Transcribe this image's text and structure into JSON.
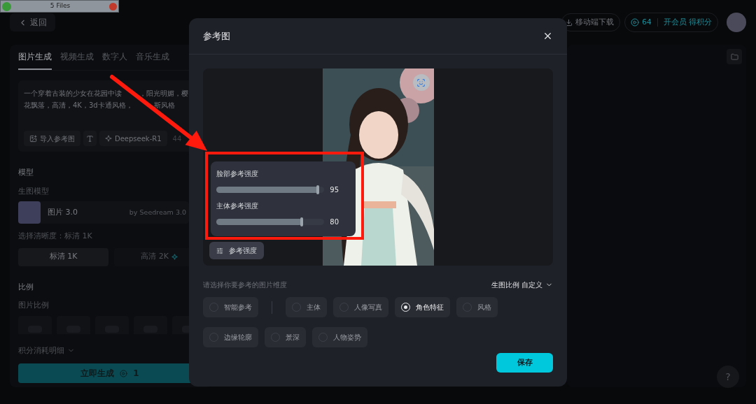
{
  "capture_bar": {
    "title": "5 Files"
  },
  "header": {
    "back": "返回",
    "mobile_download": "移动端下载",
    "points": "64",
    "membership": "开会员 得积分"
  },
  "left_panel": {
    "tabs": [
      {
        "label": "图片生成",
        "selected": true
      },
      {
        "label": "视频生成",
        "selected": false
      },
      {
        "label": "数字人",
        "selected": false
      },
      {
        "label": "音乐生成",
        "selected": false
      }
    ],
    "prompt_lines": [
      {
        "before": "一个穿着古装的少女在花园中读",
        "after": "，阳光明媚，樱"
      },
      {
        "before": "花飘落，高清，4K，3d卡通风格，",
        "after": "斯风格"
      }
    ],
    "import_button": "导入参考图",
    "model_chip": "Deepseek-R1",
    "counter": "44",
    "model_section": "模型",
    "model_label": "生图模型",
    "model": {
      "name": "图片 3.0",
      "provider": "by Seedream 3.0"
    },
    "resolution_label": "选择清晰度：标清 1K",
    "resolutions": [
      {
        "label": "标清 1K",
        "selected": true
      },
      {
        "label": "高清 2K",
        "selected": false
      }
    ],
    "ratio_section": "比例",
    "ratio_label": "图片比例",
    "cost_details": "积分消耗明细",
    "generate": {
      "label": "立即生成",
      "cost": "1"
    }
  },
  "help": "?",
  "dialog": {
    "title": "参考图",
    "sliders": [
      {
        "label": "脸部参考强度",
        "level": 0.95,
        "reading": "95"
      },
      {
        "label": "主体参考强度",
        "level": 0.8,
        "reading": "80"
      }
    ],
    "strength_button": "参考强度",
    "dimension_prompt": "请选择你要参考的图片维度",
    "ratio_dropdown": "生图比例 自定义",
    "options": [
      {
        "label": "智能参考",
        "selected": false
      },
      {
        "label": "主体",
        "selected": false
      },
      {
        "label": "人像写真",
        "selected": false
      },
      {
        "label": "角色特征",
        "selected": true
      },
      {
        "label": "风格",
        "selected": false
      },
      {
        "label": "边缘轮廓",
        "selected": false
      },
      {
        "label": "景深",
        "selected": false
      },
      {
        "label": "人物姿势",
        "selected": false
      }
    ],
    "save": "保存"
  }
}
